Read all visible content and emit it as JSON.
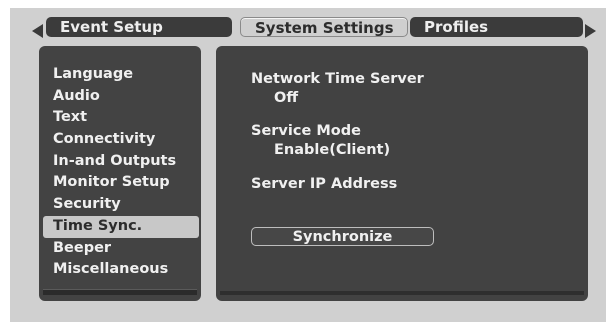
{
  "tabs": [
    {
      "label": "Event Setup",
      "active": false
    },
    {
      "label": "System Settings",
      "active": true
    },
    {
      "label": "Profiles",
      "active": false
    }
  ],
  "sidebar": {
    "items": [
      {
        "label": "Language"
      },
      {
        "label": "Audio"
      },
      {
        "label": "Text"
      },
      {
        "label": "Connectivity"
      },
      {
        "label": "In-and Outputs"
      },
      {
        "label": "Monitor Setup"
      },
      {
        "label": "Security"
      },
      {
        "label": "Time Sync.",
        "selected": true
      },
      {
        "label": "Beeper"
      },
      {
        "label": "Miscellaneous"
      }
    ]
  },
  "settings": {
    "network_time_server": {
      "label": "Network Time Server",
      "value": "Off"
    },
    "service_mode": {
      "label": "Service Mode",
      "value": "Enable(Client)"
    },
    "server_ip": {
      "label": "Server IP Address",
      "value": ""
    },
    "synchronize_button": "Synchronize"
  },
  "icons": {
    "left_arrow": "left-arrow-icon",
    "right_arrow": "right-arrow-icon"
  },
  "colors": {
    "panel_bg": "#424242",
    "highlight": "#c8c8c8",
    "text": "#f0f0f0",
    "frame": "#d0d0d0"
  }
}
